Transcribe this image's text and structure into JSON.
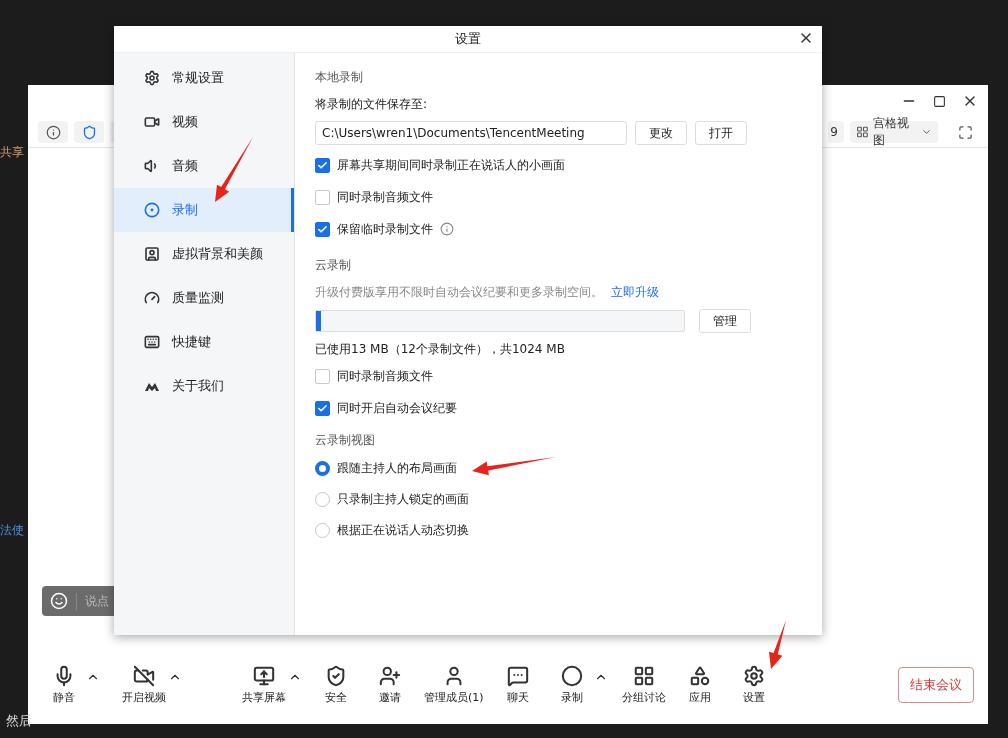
{
  "background": {
    "fragment_top": "共享",
    "fragment_middle": "法使",
    "caption": "然后"
  },
  "meeting_window": {
    "count_fragment": "9",
    "view_button": "宫格视图",
    "chat_placeholder": "说点",
    "left_controls": [
      {
        "label": "静音",
        "caret": true
      },
      {
        "label": "开启视频",
        "caret": true
      }
    ],
    "center_controls": [
      {
        "label": "共享屏幕",
        "caret": true
      },
      {
        "label": "安全",
        "caret": false
      },
      {
        "label": "邀请",
        "caret": false
      },
      {
        "label": "管理成员(1)",
        "caret": false
      },
      {
        "label": "聊天",
        "caret": false
      },
      {
        "label": "录制",
        "caret": true
      },
      {
        "label": "分组讨论",
        "caret": false
      },
      {
        "label": "应用",
        "caret": false
      },
      {
        "label": "设置",
        "caret": false
      }
    ],
    "end_button": "结束会议"
  },
  "dialog": {
    "title": "设置",
    "nav": [
      {
        "label": "常规设置",
        "selected": false
      },
      {
        "label": "视频",
        "selected": false
      },
      {
        "label": "音频",
        "selected": false
      },
      {
        "label": "录制",
        "selected": true
      },
      {
        "label": "虚拟背景和美颜",
        "selected": false
      },
      {
        "label": "质量监测",
        "selected": false
      },
      {
        "label": "快捷键",
        "selected": false
      },
      {
        "label": "关于我们",
        "selected": false
      }
    ],
    "local_recording": {
      "heading": "本地录制",
      "path_label": "将录制的文件保存至:",
      "path": "C:\\Users\\wren1\\Documents\\TencentMeeting",
      "buttons": [
        "更改",
        "打开"
      ],
      "options": [
        {
          "label": "屏幕共享期间同时录制正在说话人的小画面",
          "checked": true,
          "info": false
        },
        {
          "label": "同时录制音频文件",
          "checked": false,
          "info": false
        },
        {
          "label": "保留临时录制文件",
          "checked": true,
          "info": true
        }
      ]
    },
    "cloud_recording": {
      "heading": "云录制",
      "promo": "升级付费版享用不限时自动会议纪要和更多录制空间。",
      "promo_link": "立即升级",
      "level": 0.013,
      "manage_button": "管理",
      "usage": "已使用13 MB（12个录制文件），共1024 MB",
      "options": [
        {
          "label": "同时录制音频文件",
          "checked": false
        },
        {
          "label": "同时开启自动会议纪要",
          "checked": true
        }
      ]
    },
    "cloud_view": {
      "heading": "云录制视图",
      "options": [
        {
          "label": "跟随主持人的布局画面",
          "selected": true
        },
        {
          "label": "只录制主持人锁定的画面",
          "selected": false
        },
        {
          "label": "根据正在说话人动态切换",
          "selected": false
        }
      ]
    }
  }
}
